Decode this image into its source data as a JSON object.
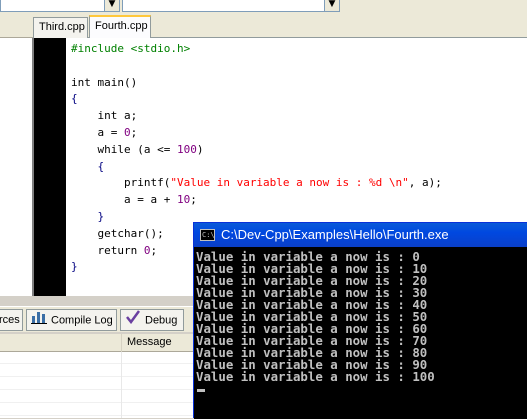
{
  "editor_tabs": [
    {
      "label": "Third.cpp",
      "active": false
    },
    {
      "label": "Fourth.cpp",
      "active": true
    }
  ],
  "code_lines": [
    [
      {
        "t": "#include <stdio.h>",
        "c": "pp"
      }
    ],
    [
      {
        "t": "",
        "c": "kw"
      }
    ],
    [
      {
        "t": "int main()",
        "c": "kw"
      }
    ],
    [
      {
        "t": "{",
        "c": "sym"
      }
    ],
    [
      {
        "t": "    int a;",
        "c": "kw"
      }
    ],
    [
      {
        "t": "    a = ",
        "c": "kw"
      },
      {
        "t": "0",
        "c": "num"
      },
      {
        "t": ";",
        "c": "kw"
      }
    ],
    [
      {
        "t": "    while (a <= ",
        "c": "kw"
      },
      {
        "t": "100",
        "c": "num"
      },
      {
        "t": ")",
        "c": "kw"
      }
    ],
    [
      {
        "t": "    {",
        "c": "sym"
      }
    ],
    [
      {
        "t": "        printf(",
        "c": "kw"
      },
      {
        "t": "\"Value in variable a now is : %d \\n\"",
        "c": "str"
      },
      {
        "t": ", a);",
        "c": "kw"
      }
    ],
    [
      {
        "t": "        a = a + ",
        "c": "kw"
      },
      {
        "t": "10",
        "c": "num"
      },
      {
        "t": ";",
        "c": "kw"
      }
    ],
    [
      {
        "t": "    }",
        "c": "sym"
      }
    ],
    [
      {
        "t": "    getchar();",
        "c": "kw"
      }
    ],
    [
      {
        "t": "    return ",
        "c": "kw"
      },
      {
        "t": "0",
        "c": "num"
      },
      {
        "t": ";",
        "c": "kw"
      }
    ],
    [
      {
        "t": "}",
        "c": "sym"
      }
    ]
  ],
  "bottom_tabs": {
    "resources_label": "rces",
    "compile_log_label": "Compile Log",
    "debug_label": "Debug"
  },
  "message_list": {
    "column_message": "Message"
  },
  "console": {
    "title": "C:\\Dev-Cpp\\Examples\\Hello\\Fourth.exe",
    "icon_text": "C:\\",
    "lines": [
      "Value in variable a now is : 0",
      "Value in variable a now is : 10",
      "Value in variable a now is : 20",
      "Value in variable a now is : 30",
      "Value in variable a now is : 40",
      "Value in variable a now is : 50",
      "Value in variable a now is : 60",
      "Value in variable a now is : 70",
      "Value in variable a now is : 80",
      "Value in variable a now is : 90",
      "Value in variable a now is : 100"
    ]
  },
  "colors": {
    "preprocessor": "#008000",
    "number": "#800080",
    "string": "#ff0000",
    "console_text": "#c0c0c0",
    "titlebar": "#0048e0"
  }
}
